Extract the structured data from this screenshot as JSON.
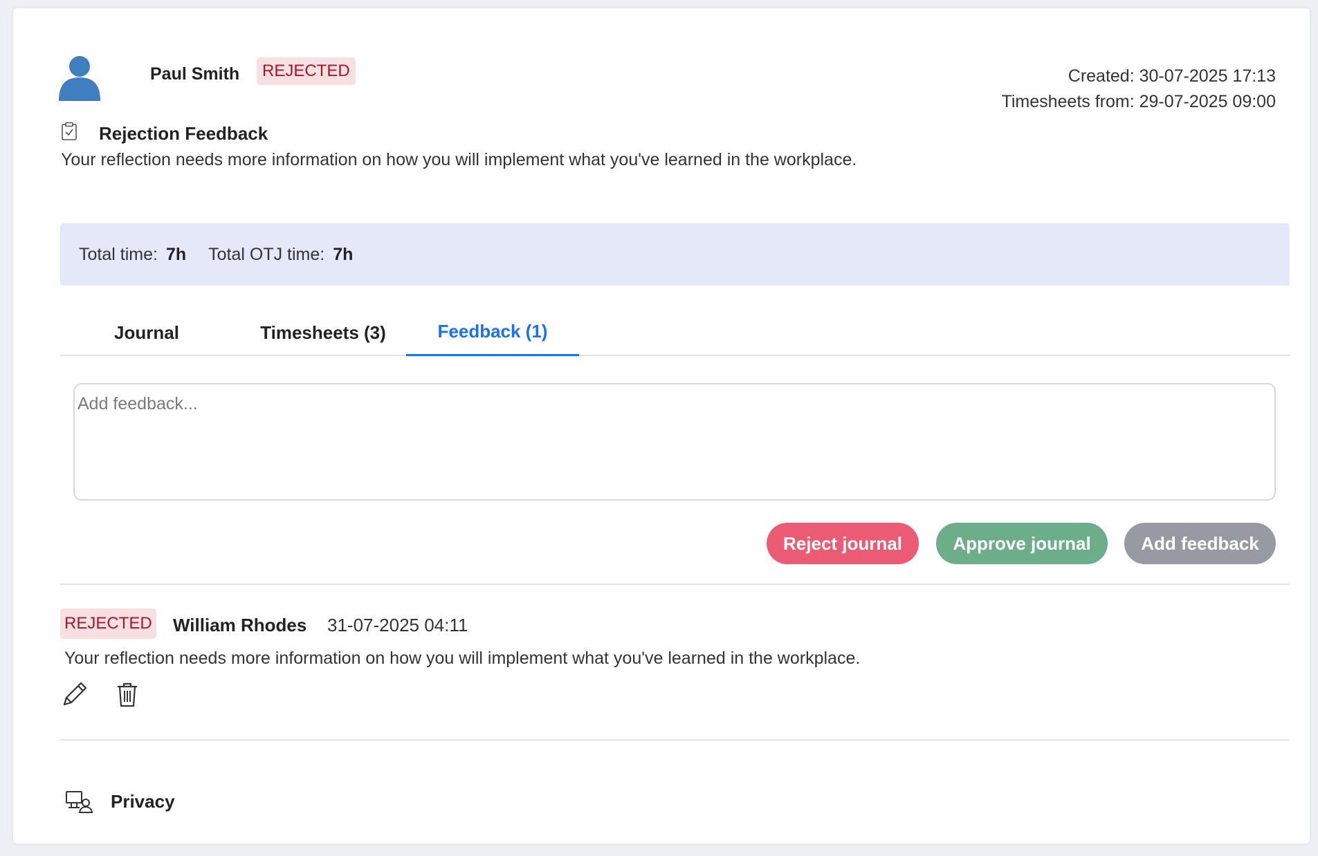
{
  "header": {
    "user_name": "Paul Smith",
    "status": "REJECTED",
    "created": "Created: 30-07-2025 17:13",
    "timesheets_from": "Timesheets from: 29-07-2025 09:00"
  },
  "rejection": {
    "title": "Rejection Feedback",
    "text": "Your reflection needs more information on how you will implement what you've learned in the workplace."
  },
  "totals": {
    "total_time_label": "Total time:",
    "total_time_value": "7h",
    "total_otj_label": "Total OTJ time:",
    "total_otj_value": "7h"
  },
  "tabs": [
    {
      "label": "Journal",
      "active": false
    },
    {
      "label": "Timesheets (3)",
      "active": false
    },
    {
      "label": "Feedback (1)",
      "active": true
    }
  ],
  "feedback_input": {
    "placeholder": "Add feedback..."
  },
  "actions": {
    "reject": "Reject journal",
    "approve": "Approve journal",
    "add": "Add feedback"
  },
  "entries": [
    {
      "status": "REJECTED",
      "author": "William Rhodes",
      "date": "31-07-2025 04:11",
      "text": "Your reflection needs more information on how you will implement what you've learned in the workplace."
    }
  ],
  "footer": {
    "privacy": "Privacy"
  },
  "colors": {
    "accent": "#1a72e8",
    "reject": "#ec5b74",
    "approve": "#6cad8a",
    "neutral": "#979aa3",
    "badge_bg": "#f7dfe2",
    "badge_text": "#a01a2c",
    "totals_bg": "#e4e8f8",
    "avatar": "#3f7fbf"
  },
  "icons": [
    "user-avatar-icon",
    "clipboard-check-icon",
    "pencil-icon",
    "trash-icon",
    "privacy-icon"
  ]
}
